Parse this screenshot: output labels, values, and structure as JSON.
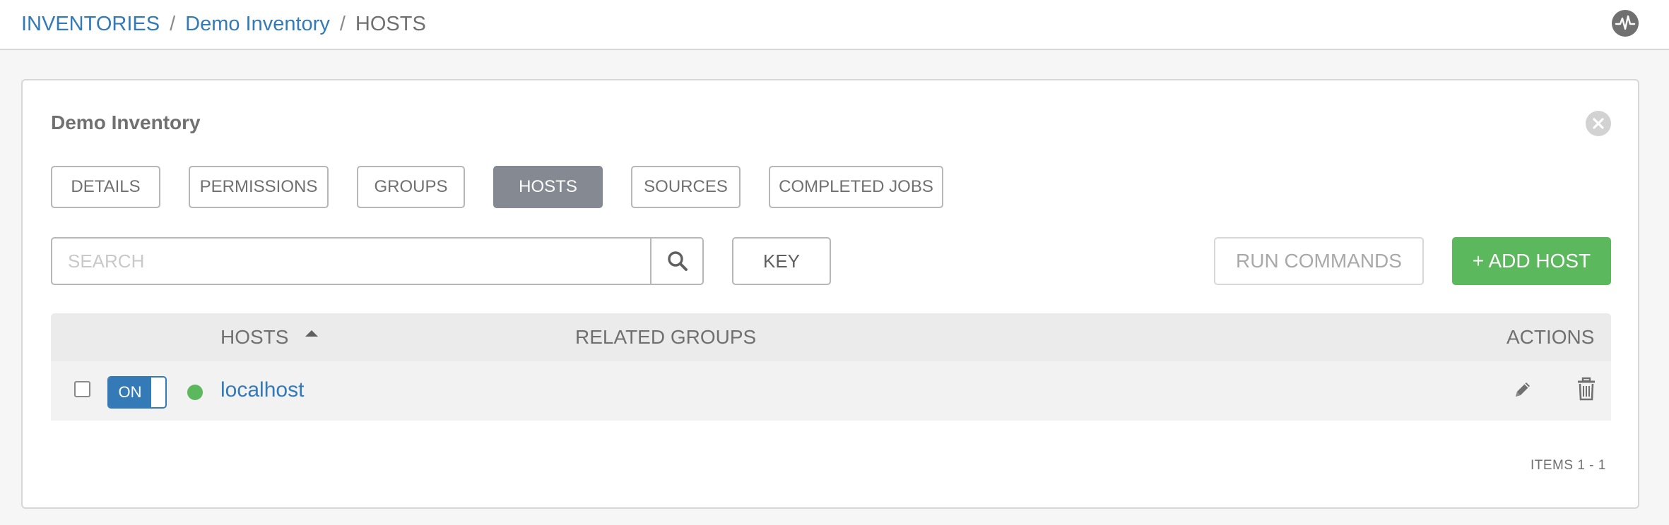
{
  "breadcrumb": {
    "inventories": "INVENTORIES",
    "separator": "/",
    "inventory_name": "Demo Inventory",
    "current": "HOSTS"
  },
  "header": {
    "activity_icon": "activity-stream-icon"
  },
  "panel": {
    "title": "Demo Inventory",
    "close_icon": "close-icon"
  },
  "tabs": [
    {
      "label": "DETAILS",
      "active": false
    },
    {
      "label": "PERMISSIONS",
      "active": false
    },
    {
      "label": "GROUPS",
      "active": false
    },
    {
      "label": "HOSTS",
      "active": true
    },
    {
      "label": "SOURCES",
      "active": false
    },
    {
      "label": "COMPLETED JOBS",
      "active": false
    }
  ],
  "search": {
    "placeholder": "SEARCH",
    "value": "",
    "button_icon": "search-icon"
  },
  "toolbar": {
    "key_label": "KEY",
    "run_commands_label": "RUN COMMANDS",
    "add_host_label": "+ ADD HOST"
  },
  "table": {
    "columns": {
      "hosts": "HOSTS",
      "related_groups": "RELATED GROUPS",
      "actions": "ACTIONS"
    },
    "sort_icon": "sort-ascending-icon",
    "rows": [
      {
        "checked": false,
        "toggle_label": "ON",
        "status": "success",
        "status_color": "#5cb85c",
        "name": "localhost",
        "related_groups": "",
        "action_icons": [
          "edit-icon",
          "delete-icon"
        ]
      }
    ]
  },
  "pagination": {
    "items_label": "ITEMS  1 - 1"
  },
  "colors": {
    "link": "#337ab7",
    "success": "#5cb85c",
    "active_tab": "#848992"
  }
}
